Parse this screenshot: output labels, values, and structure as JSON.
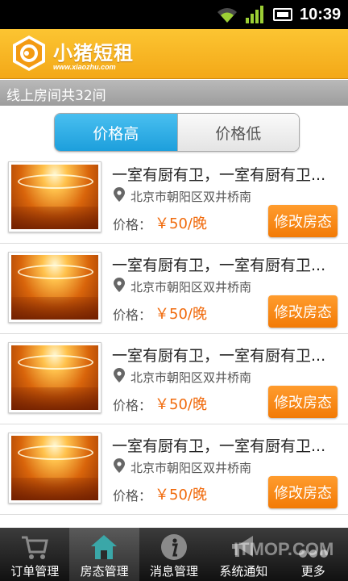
{
  "status_bar": {
    "time": "10:39"
  },
  "header": {
    "brand_name": "小猪短租",
    "brand_url": "www.xiaozhu.com"
  },
  "summary": {
    "text": "线上房间共32间"
  },
  "sort": {
    "high_label": "价格高",
    "low_label": "价格低",
    "selected": "价格高"
  },
  "listings": [
    {
      "title": "一室有厨有卫，一室有厨有卫...",
      "address": "北京市朝阳区双井桥南",
      "price_label": "价格：",
      "price": "￥50/晚",
      "button": "修改房态"
    },
    {
      "title": "一室有厨有卫，一室有厨有卫...",
      "address": "北京市朝阳区双井桥南",
      "price_label": "价格：",
      "price": "￥50/晚",
      "button": "修改房态"
    },
    {
      "title": "一室有厨有卫，一室有厨有卫...",
      "address": "北京市朝阳区双井桥南",
      "price_label": "价格：",
      "price": "￥50/晚",
      "button": "修改房态"
    },
    {
      "title": "一室有厨有卫，一室有厨有卫...",
      "address": "北京市朝阳区双井桥南",
      "price_label": "价格：",
      "price": "￥50/晚",
      "button": "修改房态"
    }
  ],
  "bottom_nav": [
    {
      "label": "订单管理",
      "icon": "cart-icon",
      "active": false
    },
    {
      "label": "房态管理",
      "icon": "house-icon",
      "active": true
    },
    {
      "label": "消息管理",
      "icon": "info-icon",
      "active": false
    },
    {
      "label": "系统通知",
      "icon": "megaphone-icon",
      "active": false
    },
    {
      "label": "更多",
      "icon": "more-icon",
      "active": false
    }
  ],
  "watermark": "ITMOP.COM",
  "colors": {
    "accent_orange": "#f27a06",
    "header_yellow": "#fcc532",
    "tab_blue": "#1d9fdc",
    "price_orange": "#f06a0c"
  }
}
